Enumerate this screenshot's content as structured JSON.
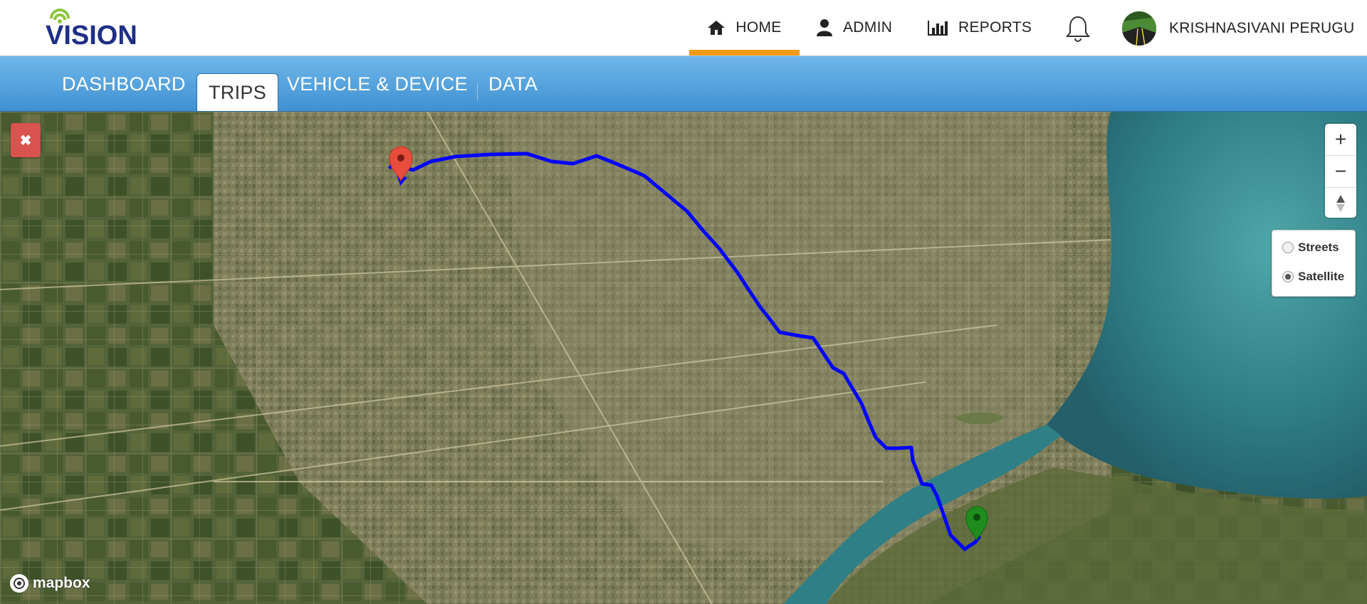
{
  "brand": {
    "name": "VISION"
  },
  "nav": {
    "home": "HOME",
    "admin": "ADMIN",
    "reports": "REPORTS",
    "user": "KRISHNASIVANI PERUGU"
  },
  "tabs": {
    "dashboard": "DASHBOARD",
    "trips": "TRIPS",
    "vehicle": "VEHICLE & DEVICE",
    "data": "DATA"
  },
  "map": {
    "layers": {
      "streets": "Streets",
      "satellite": "Satellite",
      "selected": "Satellite"
    },
    "attribution": "mapbox",
    "zoom_in": "+",
    "zoom_out": "−",
    "close": "✖"
  },
  "colors": {
    "accent": "#f39c12",
    "tabbar": "#4a9ad8",
    "route": "#0000ff",
    "start_marker": "#e74c3c",
    "end_marker": "#1e8c1e",
    "close_button": "#d9534f"
  }
}
